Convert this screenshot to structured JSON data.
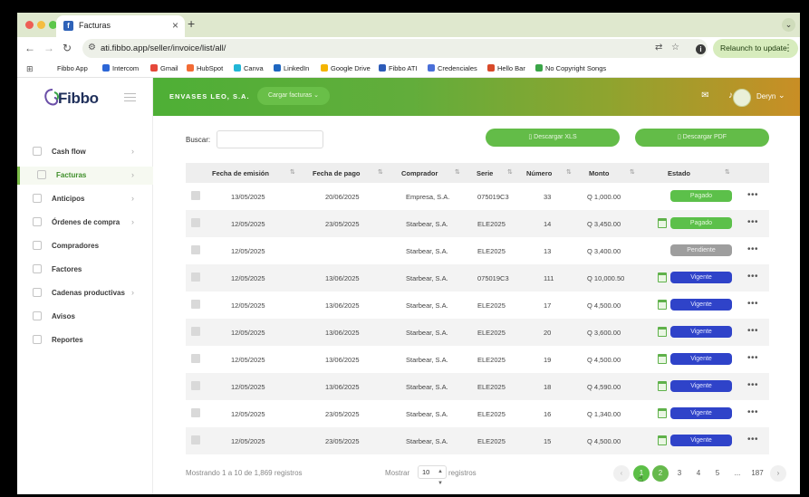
{
  "browser": {
    "tab_title": "Facturas",
    "tab_close": "×",
    "new_tab": "+",
    "url": "ati.fibbo.app/seller/invoice/list/all/",
    "relaunch_label": "Relaunch to update",
    "info": "i",
    "bookmarks": [
      {
        "label": "Fibbo App",
        "color": "#ffffff"
      },
      {
        "label": "Intercom",
        "color": "#2c66d6"
      },
      {
        "label": "Gmail",
        "color": "#e5483a"
      },
      {
        "label": "HubSpot",
        "color": "#f26b35"
      },
      {
        "label": "Canva",
        "color": "#22b6d6"
      },
      {
        "label": "LinkedIn",
        "color": "#1e66c0"
      },
      {
        "label": "Google Drive",
        "color": "#f4b400"
      },
      {
        "label": "Fibbo ATI",
        "color": "#2d5bb8"
      },
      {
        "label": "Credenciales",
        "color": "#4a6fd8"
      },
      {
        "label": "Hello Bar",
        "color": "#d84a2a"
      },
      {
        "label": "No Copyright Songs",
        "color": "#3aa548"
      }
    ]
  },
  "sidebar": {
    "logo": "Fibbo",
    "items": [
      {
        "label": "Cash flow",
        "has_chevron": true
      },
      {
        "label": "Facturas",
        "has_chevron": true,
        "active": true
      },
      {
        "label": "Anticipos",
        "has_chevron": true
      },
      {
        "label": "Órdenes de compra",
        "has_chevron": true
      },
      {
        "label": "Compradores",
        "has_chevron": false
      },
      {
        "label": "Factores",
        "has_chevron": false
      },
      {
        "label": "Cadenas productivas",
        "has_chevron": true
      },
      {
        "label": "Avisos",
        "has_chevron": false
      },
      {
        "label": "Reportes",
        "has_chevron": false
      }
    ]
  },
  "header": {
    "company": "ENVASES LEO, S.A.",
    "cargar_label": "Cargar facturas",
    "user_name": "Deryn"
  },
  "main": {
    "search_label": "Buscar:",
    "search_value": "",
    "download_xls": "Descargar XLS",
    "download_pdf": "Descargar PDF",
    "columns": [
      "Fecha de emisión",
      "Fecha de pago",
      "Comprador",
      "Serie",
      "Número",
      "Monto",
      "Estado"
    ],
    "rows": [
      {
        "emision": "13/05/2025",
        "pago": "20/06/2025",
        "comprador": "Empresa, S.A.",
        "serie": "075019C3",
        "numero": "33",
        "monto": "Q 1,000.00",
        "estado": "Pagado",
        "status_type": "pagado",
        "calendar": false
      },
      {
        "emision": "12/05/2025",
        "pago": "23/05/2025",
        "comprador": "Starbear, S.A.",
        "serie": "ELE2025",
        "numero": "14",
        "monto": "Q 3,450.00",
        "estado": "Pagado",
        "status_type": "pagado",
        "calendar": true
      },
      {
        "emision": "12/05/2025",
        "pago": "",
        "comprador": "Starbear, S.A.",
        "serie": "ELE2025",
        "numero": "13",
        "monto": "Q 3,400.00",
        "estado": "Pendiente",
        "status_type": "pendiente",
        "calendar": false
      },
      {
        "emision": "12/05/2025",
        "pago": "13/06/2025",
        "comprador": "Starbear, S.A.",
        "serie": "075019C3",
        "numero": "111",
        "monto": "Q 10,000.50",
        "estado": "Vigente",
        "status_type": "vigente",
        "calendar": true
      },
      {
        "emision": "12/05/2025",
        "pago": "13/06/2025",
        "comprador": "Starbear, S.A.",
        "serie": "ELE2025",
        "numero": "17",
        "monto": "Q 4,500.00",
        "estado": "Vigente",
        "status_type": "vigente",
        "calendar": true
      },
      {
        "emision": "12/05/2025",
        "pago": "13/06/2025",
        "comprador": "Starbear, S.A.",
        "serie": "ELE2025",
        "numero": "20",
        "monto": "Q 3,600.00",
        "estado": "Vigente",
        "status_type": "vigente",
        "calendar": true
      },
      {
        "emision": "12/05/2025",
        "pago": "13/06/2025",
        "comprador": "Starbear, S.A.",
        "serie": "ELE2025",
        "numero": "19",
        "monto": "Q 4,500.00",
        "estado": "Vigente",
        "status_type": "vigente",
        "calendar": true
      },
      {
        "emision": "12/05/2025",
        "pago": "13/06/2025",
        "comprador": "Starbear, S.A.",
        "serie": "ELE2025",
        "numero": "18",
        "monto": "Q 4,590.00",
        "estado": "Vigente",
        "status_type": "vigente",
        "calendar": true
      },
      {
        "emision": "12/05/2025",
        "pago": "23/05/2025",
        "comprador": "Starbear, S.A.",
        "serie": "ELE2025",
        "numero": "16",
        "monto": "Q 1,340.00",
        "estado": "Vigente",
        "status_type": "vigente",
        "calendar": true
      },
      {
        "emision": "12/05/2025",
        "pago": "23/05/2025",
        "comprador": "Starbear, S.A.",
        "serie": "ELE2025",
        "numero": "15",
        "monto": "Q 4,500.00",
        "estado": "Vigente",
        "status_type": "vigente",
        "calendar": true
      }
    ],
    "footer_info": "Mostrando 1 a 10 de 1,869 registros",
    "mostrar_label": "Mostrar",
    "page_size": "10",
    "registros_label": "registros",
    "pages": [
      "1",
      "2",
      "3",
      "4",
      "5",
      "...",
      "187"
    ],
    "current_page": "1"
  },
  "colors": {
    "brand_green": "#5cbf47",
    "vigente_blue": "#2f43c9",
    "pendiente_gray": "#9e9e9e"
  }
}
